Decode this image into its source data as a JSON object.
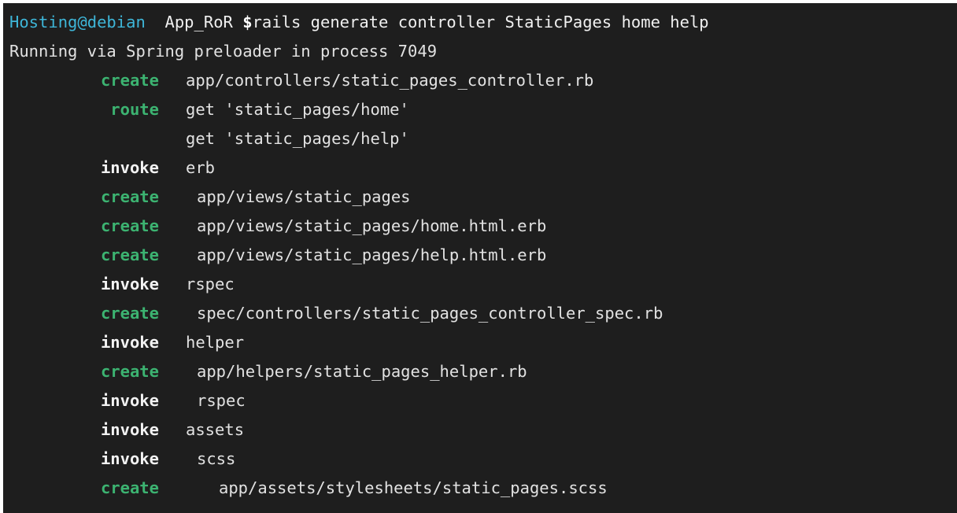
{
  "prompt": {
    "user_host": "Hosting@debian",
    "directory": "App_RoR",
    "dollar": "$",
    "command": "rails generate controller StaticPages home help"
  },
  "output": {
    "running_line": "Running via Spring preloader in process 7049",
    "rows": [
      {
        "action": "create",
        "arg": "app/controllers/static_pages_controller.rb"
      },
      {
        "action": "route",
        "arg": "get 'static_pages/home'"
      },
      {
        "action": "",
        "arg": "get 'static_pages/help'"
      },
      {
        "action": "invoke",
        "arg": "erb"
      },
      {
        "action": "create",
        "arg": "app/views/static_pages"
      },
      {
        "action": "create",
        "arg": "app/views/static_pages/home.html.erb"
      },
      {
        "action": "create",
        "arg": "app/views/static_pages/help.html.erb"
      },
      {
        "action": "invoke",
        "arg": "rspec"
      },
      {
        "action": "create",
        "arg": "spec/controllers/static_pages_controller_spec.rb"
      },
      {
        "action": "invoke",
        "arg": "helper"
      },
      {
        "action": "create",
        "arg": "app/helpers/static_pages_helper.rb"
      },
      {
        "action": "invoke",
        "arg": "rspec"
      },
      {
        "action": "invoke",
        "arg": "assets"
      },
      {
        "action": "invoke",
        "arg": "scss"
      },
      {
        "action": "create",
        "arg": "app/assets/stylesheets/static_pages.scss"
      }
    ]
  },
  "colors": {
    "background": "#1e1e1e",
    "prompt_user": "#3eb6d8",
    "create_action": "#3cb371",
    "invoke_action": "#f2f2f2",
    "text": "#e2e2e2"
  }
}
